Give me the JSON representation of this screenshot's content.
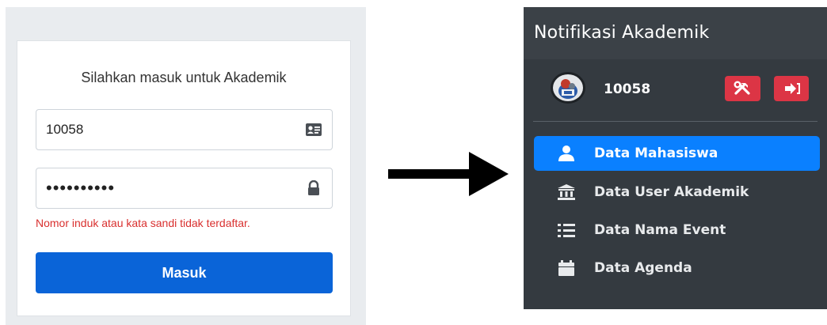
{
  "login": {
    "title": "Silahkan masuk untuk Akademik",
    "username_value": "10058",
    "password_value": "••••••••••",
    "error": "Nomor induk atau kata sandi tidak terdaftar.",
    "submit_label": "Masuk"
  },
  "sidebar": {
    "brand": "Notifikasi Akademik",
    "user_id": "10058",
    "items": [
      {
        "label": "Data Mahasiswa",
        "icon": "user-icon",
        "active": true
      },
      {
        "label": "Data User Akademik",
        "icon": "university-icon",
        "active": false
      },
      {
        "label": "Data Nama Event",
        "icon": "list-icon",
        "active": false
      },
      {
        "label": "Data Agenda",
        "icon": "calendar-icon",
        "active": false
      }
    ]
  },
  "colors": {
    "primary": "#0a64d8",
    "active_nav": "#0a80ff",
    "danger": "#dc3545",
    "error_text": "#d9302f",
    "sidebar_bg": "#343a40"
  }
}
